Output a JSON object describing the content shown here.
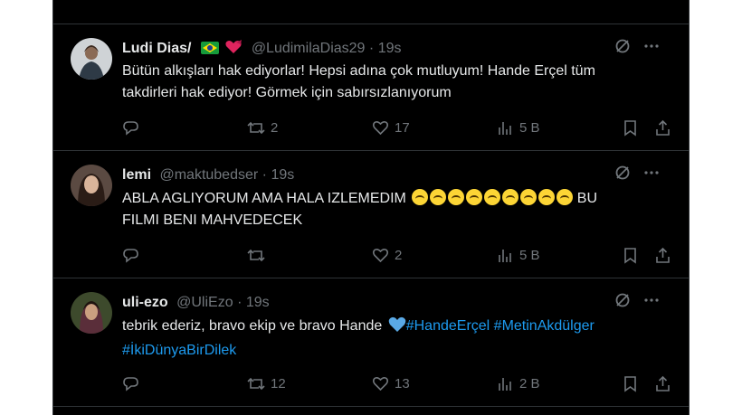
{
  "tweets": [
    {
      "name": "Ludi Dias/",
      "handle": "@LudimilaDias29",
      "separator": "·",
      "time": "19s",
      "text_line1": "Bütün alkışları hak ediyorlar! Hepsi adına çok mutluyum! Hande Erçel tüm",
      "text_line2": "takdirleri hak ediyor! Görmek için sabırsızlanıyorum",
      "retweets": "2",
      "likes": "17",
      "views": "5 B"
    },
    {
      "name": "lemi",
      "handle": "@maktubedser",
      "separator": "·",
      "time": "19s",
      "text_line1a": "ABLA AGLIYORUM AMA HALA IZLEMEDIM",
      "text_line1b": "BU",
      "text_line2": "FILMI BENI MAHVEDECEK",
      "retweets": "",
      "likes": "2",
      "views": "5 B"
    },
    {
      "name": "uli-ezo",
      "handle": "@UliEzo",
      "separator": "·",
      "time": "19s",
      "text_plain": "tebrik ederiz, bravo ekip ve bravo Hande",
      "hashtag1": "#HandeErçel",
      "hashtag2": "#MetinAkdülger",
      "hashtag3": "#İkiDünyaBirDilek",
      "retweets": "12",
      "likes": "13",
      "views": "2 B"
    }
  ],
  "colors": {
    "background": "#000000",
    "text": "#e7e9ea",
    "muted": "#71767b",
    "link": "#1d9bf0",
    "divider": "#2f3336"
  }
}
